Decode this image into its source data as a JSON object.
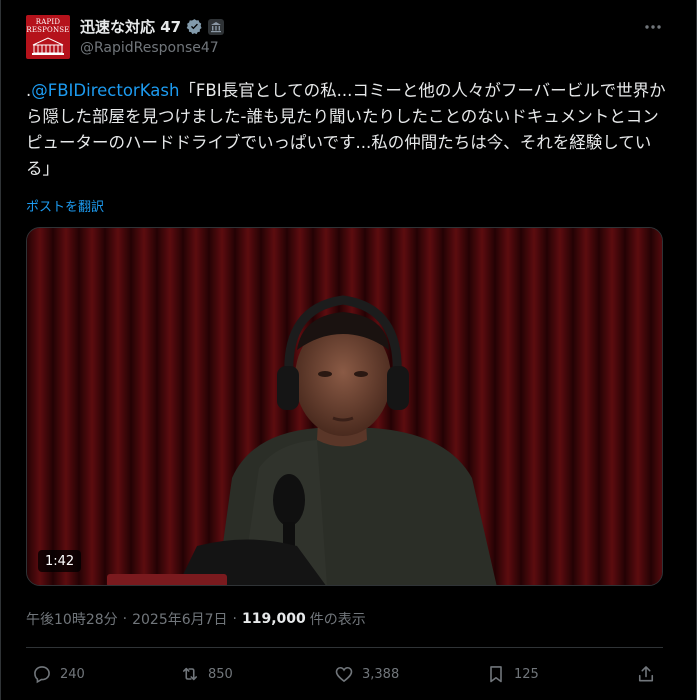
{
  "account": {
    "display_name": "迅速な対応 47",
    "handle": "@RapidResponse47",
    "avatar_line1": "RAPID",
    "avatar_line2": "RESPONSE",
    "icons": [
      "verified-badge-icon",
      "government-building-icon",
      "more-icon"
    ]
  },
  "post": {
    "prefix": ".",
    "mention": "@FBIDirectorKash",
    "text": "「FBI長官としての私...コミーと他の人々がフーバービルで世界から隠した部屋を見つけました-誰も見たり聞いたりしたことのないドキュメントとコンピューターのハードドライブでいっぱいです...私の仲間たちは今、それを経験している」",
    "translate_label": "ポストを翻訳"
  },
  "media": {
    "duration": "1:42"
  },
  "meta": {
    "time": "午後10時28分",
    "separator": "·",
    "date": "2025年6月7日",
    "views": "119,000",
    "views_label": "件の表示"
  },
  "actions": {
    "replies": "240",
    "reposts": "850",
    "likes": "3,388",
    "bookmarks": "125"
  },
  "colors": {
    "background": "#000000",
    "text": "#e7e9ea",
    "muted": "#71767b",
    "link": "#1d9bf0",
    "border": "#2f3336",
    "avatar_red": "#b5121b"
  }
}
